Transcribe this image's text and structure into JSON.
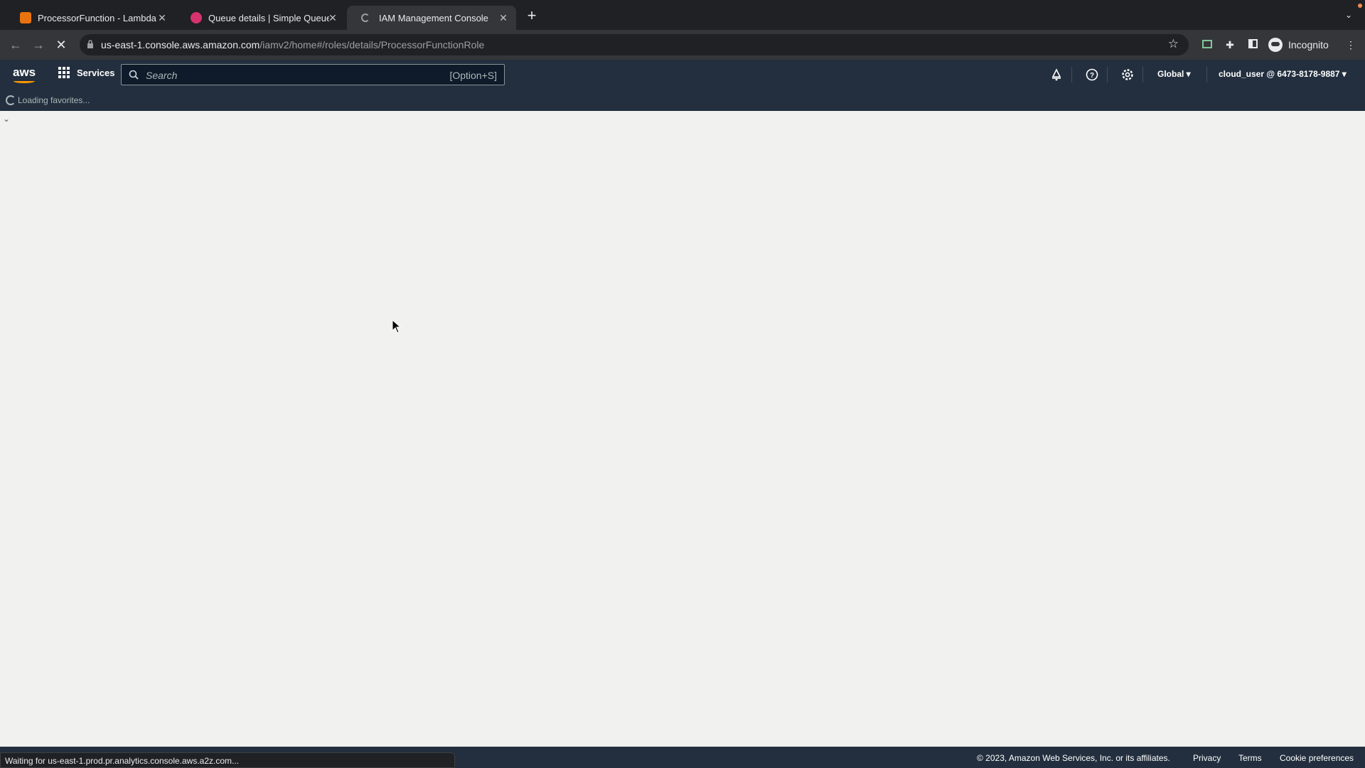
{
  "browser": {
    "tabs": [
      {
        "title": "ProcessorFunction - Lambda",
        "favicon_color": "#e8730f",
        "active": false
      },
      {
        "title": "Queue details | Simple Queue",
        "favicon_color": "#d6336c",
        "active": false
      },
      {
        "title": "IAM Management Console",
        "favicon_color": "#9aa0a6",
        "active": true
      }
    ],
    "url_host": "us-east-1.console.aws.amazon.com",
    "url_path": "/iamv2/home#/roles/details/ProcessorFunctionRole",
    "profile_label": "Incognito",
    "status_text": "Waiting for us-east-1.prod.pr.analytics.console.aws.a2z.com..."
  },
  "aws": {
    "services_label": "Services",
    "search_placeholder": "Search",
    "search_shortcut": "[Option+S]",
    "region_label": "Global ▾",
    "account_label": "cloud_user @ 6473-8178-9887 ▾",
    "favorites_loading": "Loading favorites...",
    "accent_color": "#ff9900",
    "header_color": "#232f3e"
  },
  "footer": {
    "copyright": "© 2023, Amazon Web Services, Inc. or its affiliates.",
    "links": [
      "Privacy",
      "Terms",
      "Cookie preferences"
    ]
  }
}
